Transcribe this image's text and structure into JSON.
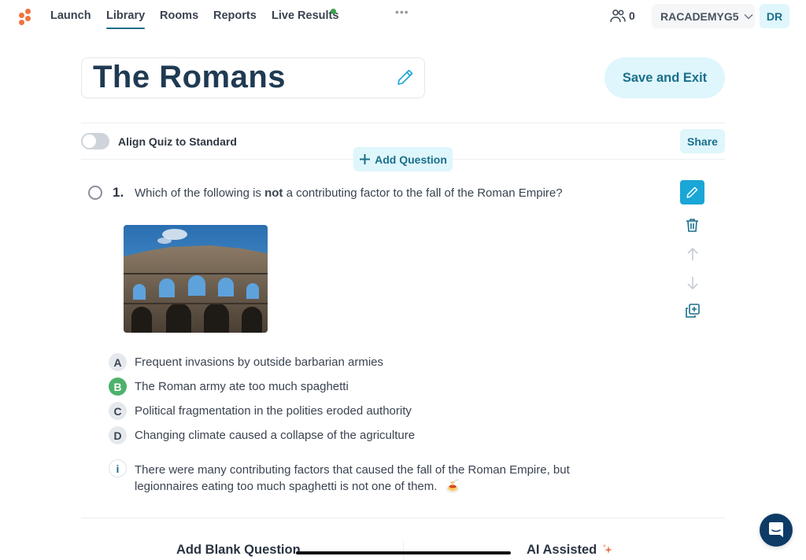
{
  "nav": {
    "links": [
      {
        "label": "Launch",
        "active": false
      },
      {
        "label": "Library",
        "active": true
      },
      {
        "label": "Rooms",
        "active": false
      },
      {
        "label": "Reports",
        "active": false
      },
      {
        "label": "Live Results",
        "active": false,
        "live_indicator": true
      }
    ],
    "more_label": "•••",
    "student_count": "0",
    "class_name": "RACADEMYG5",
    "user_initials": "DR"
  },
  "quiz": {
    "title": "The Romans",
    "save_exit_label": "Save and Exit",
    "align_label": "Align Quiz to Standard",
    "align_enabled": false,
    "share_label": "Share",
    "add_question_label": "Add Question"
  },
  "question": {
    "number": "1.",
    "text_before": "Which of the following is ",
    "text_bold": "not",
    "text_after": " a contributing factor to the fall of the Roman Empire?",
    "image_alt": "Colosseum",
    "options": [
      {
        "letter": "A",
        "text": "Frequent invasions by outside barbarian armies",
        "correct": false
      },
      {
        "letter": "B",
        "text": "The Roman army ate too much spaghetti",
        "correct": true
      },
      {
        "letter": "C",
        "text": "Political fragmentation in the polities eroded authority",
        "correct": false
      },
      {
        "letter": "D",
        "text": "Changing climate caused a collapse of the agriculture",
        "correct": false
      }
    ],
    "explanation_icon": "i",
    "explanation": "There were many contributing factors that caused the fall of the Roman Empire, but legionnaires eating too much spaghetti is not one of them.",
    "explanation_emoji": "🍝"
  },
  "footer": {
    "add_blank_label": "Add Blank Question",
    "ai_assisted_label": "AI Assisted"
  },
  "colors": {
    "accent": "#1a6f8b",
    "accent_bg": "#dff6fc",
    "primary_button": "#1aa6d6",
    "correct": "#4db26b",
    "logo": "#f0743e",
    "title": "#1f3a52",
    "chat": "#0d3b66"
  }
}
